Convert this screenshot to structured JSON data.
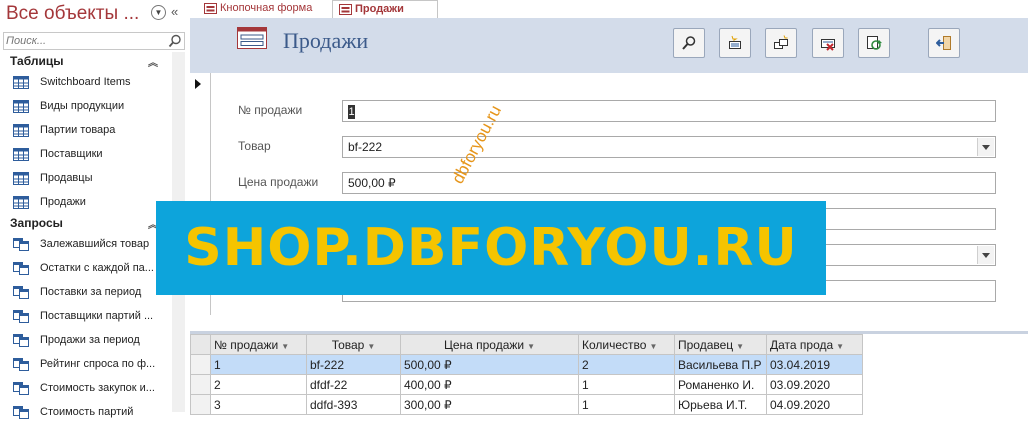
{
  "nav": {
    "title": "Все объекты ...",
    "search_placeholder": "Поиск...",
    "groups": [
      {
        "label": "Таблицы",
        "items": [
          "Switchboard Items",
          "Виды продукции",
          "Партии товара",
          "Поставщики",
          "Продавцы",
          "Продажи"
        ]
      },
      {
        "label": "Запросы",
        "items": [
          "Залежавшийся товар",
          "Остатки с каждой па...",
          "Поставки за период",
          "Поставщики партий ...",
          "Продажи за период",
          "Рейтинг спроса по ф...",
          "Стоимость закупок и...",
          "Стоимость партий"
        ]
      }
    ]
  },
  "tabs": [
    {
      "label": "Кнопочная форма"
    },
    {
      "label": "Продажи"
    }
  ],
  "form": {
    "title": "Продажи",
    "toolbar_icons": [
      "find-icon",
      "new-record-icon",
      "copy-record-icon",
      "delete-record-icon",
      "refresh-icon",
      "close-form-icon"
    ],
    "fields": [
      {
        "label": "№ продажи",
        "value": "1"
      },
      {
        "label": "Товар",
        "value": "bf-222"
      },
      {
        "label": "Цена продажи",
        "value": "500,00 ₽"
      },
      {
        "label": "",
        "value": ""
      },
      {
        "label": "",
        "value": ""
      },
      {
        "label": "",
        "value": ""
      }
    ]
  },
  "sheet": {
    "columns": [
      "№ продажи",
      "Товар",
      "Цена продажи",
      "Количество",
      "Продавец",
      "Дата прода"
    ],
    "rows": [
      [
        "1",
        "bf-222",
        "500,00 ₽",
        "2",
        "Васильева П.Р",
        "03.04.2019"
      ],
      [
        "2",
        "dfdf-22",
        "400,00 ₽",
        "1",
        "Романенко И.",
        "03.09.2020"
      ],
      [
        "3",
        "ddfd-393",
        "300,00 ₽",
        "1",
        "Юрьева И.Т.",
        "04.09.2020"
      ]
    ]
  },
  "watermark": {
    "banner": "SHOP.DBFORYOU.RU",
    "diagonal": "dbforyou.ru"
  },
  "colors": {
    "accent": "#a4373a",
    "header_bg": "#d3dcea",
    "title": "#3b5a8a",
    "banner_bg": "#0da4db",
    "banner_text": "#f5c400",
    "selected_row": "#c3dcf8"
  }
}
